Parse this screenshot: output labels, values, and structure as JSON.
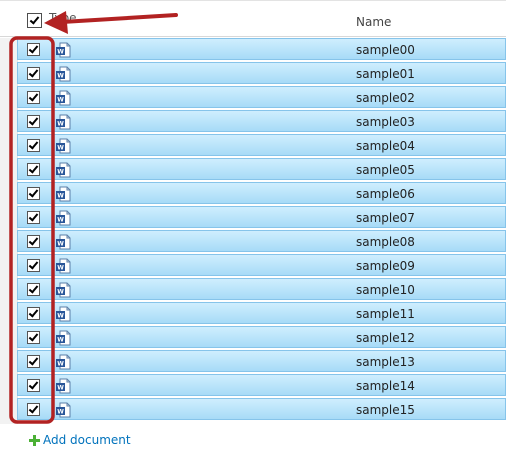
{
  "header": {
    "type_label": "Type",
    "name_label": "Name"
  },
  "rows": [
    {
      "name": "sample00",
      "icon": "word-document-icon",
      "checked": true
    },
    {
      "name": "sample01",
      "icon": "word-document-icon",
      "checked": true
    },
    {
      "name": "sample02",
      "icon": "word-document-icon",
      "checked": true
    },
    {
      "name": "sample03",
      "icon": "word-document-icon",
      "checked": true
    },
    {
      "name": "sample04",
      "icon": "word-document-icon",
      "checked": true
    },
    {
      "name": "sample05",
      "icon": "word-document-icon",
      "checked": true
    },
    {
      "name": "sample06",
      "icon": "word-document-icon",
      "checked": true
    },
    {
      "name": "sample07",
      "icon": "word-document-icon",
      "checked": true
    },
    {
      "name": "sample08",
      "icon": "word-document-icon",
      "checked": true
    },
    {
      "name": "sample09",
      "icon": "word-document-icon",
      "checked": true
    },
    {
      "name": "sample10",
      "icon": "word-document-icon",
      "checked": true
    },
    {
      "name": "sample11",
      "icon": "word-document-icon",
      "checked": true
    },
    {
      "name": "sample12",
      "icon": "word-document-icon",
      "checked": true
    },
    {
      "name": "sample13",
      "icon": "word-document-icon",
      "checked": true
    },
    {
      "name": "sample14",
      "icon": "word-document-icon",
      "checked": true
    },
    {
      "name": "sample15",
      "icon": "word-document-icon",
      "checked": true
    }
  ],
  "footer": {
    "add_document_label": "Add document"
  },
  "colors": {
    "row_selected": "#a7dbf7",
    "row_border": "#86c4ea",
    "annotation": "#b22222",
    "link": "#0072bc",
    "plus": "#4bb035"
  }
}
